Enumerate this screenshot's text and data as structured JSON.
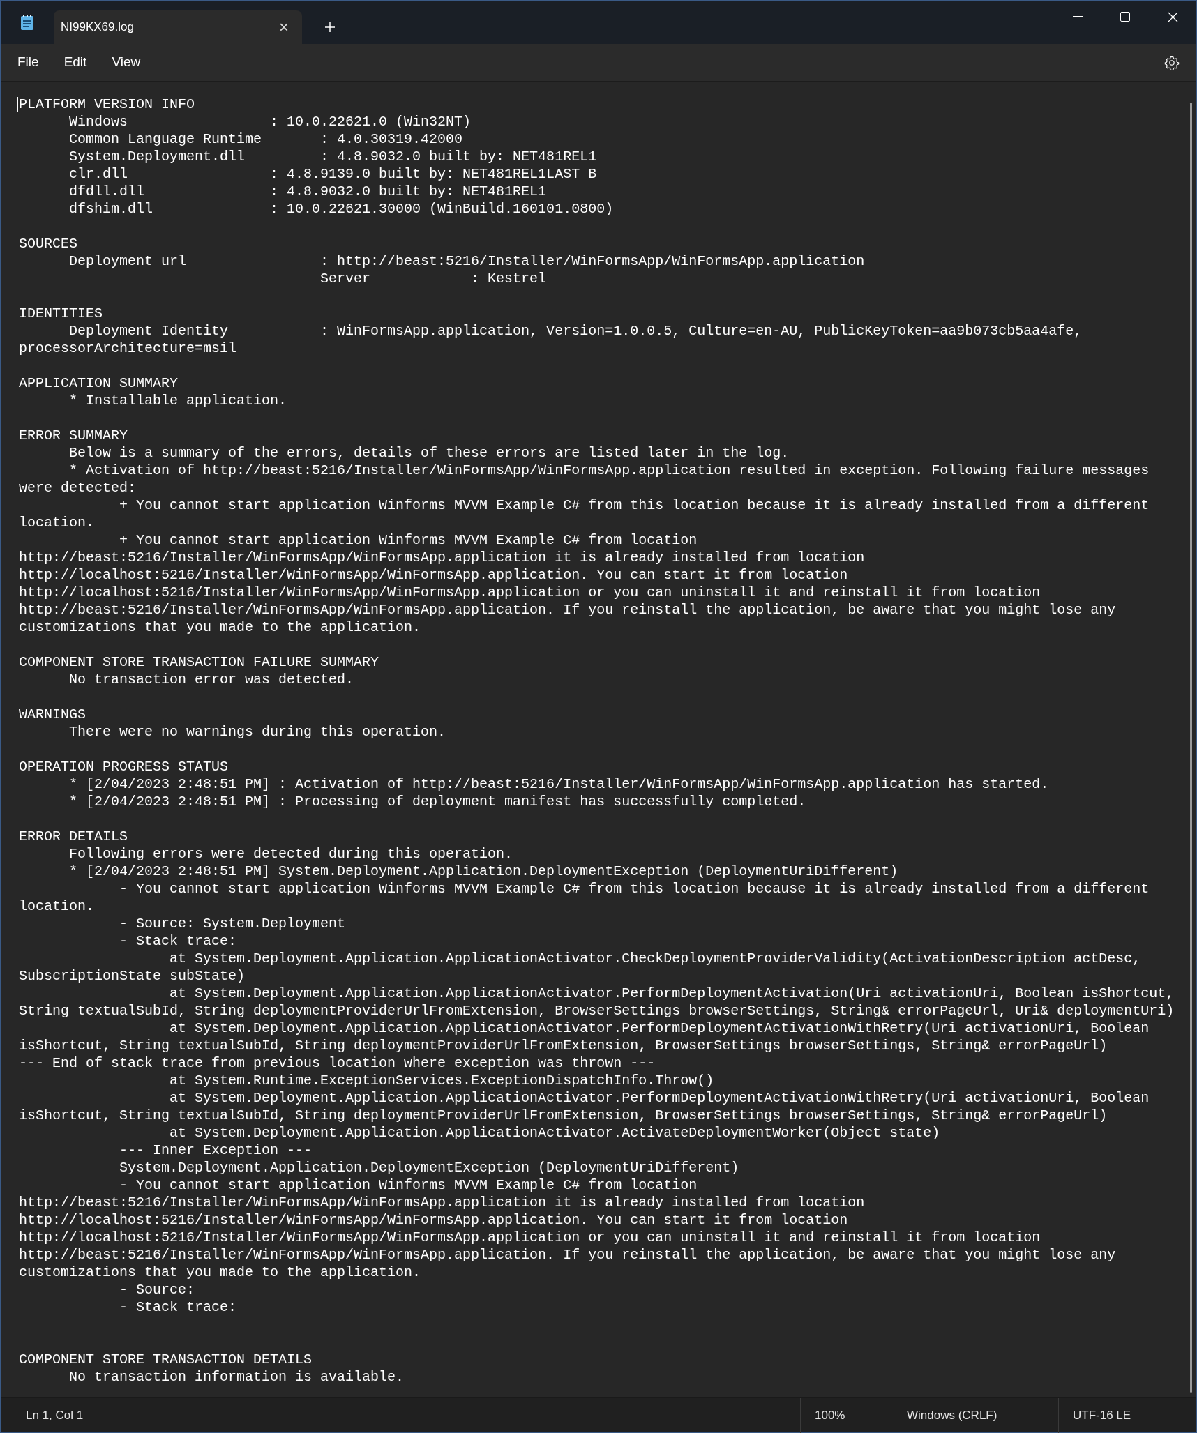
{
  "tabs": [
    {
      "label": "NI99KX69.log",
      "selected": true,
      "close": "×"
    }
  ],
  "menu": [
    "File",
    "Edit",
    "View"
  ],
  "editor": {
    "sections": [
      {
        "kind": "block",
        "lines": [
          "PLATFORM VERSION INFO",
          "      Windows                 : 10.0.22621.0 (Win32NT)",
          "      Common Language Runtime       : 4.0.30319.42000",
          "      System.Deployment.dll         : 4.8.9032.0 built by: NET481REL1",
          "      clr.dll                 : 4.8.9139.0 built by: NET481REL1LAST_B",
          "      dfdll.dll               : 4.8.9032.0 built by: NET481REL1",
          "      dfshim.dll              : 10.0.22621.30000 (WinBuild.160101.0800)"
        ]
      },
      {
        "kind": "block",
        "lines": [
          "SOURCES",
          "      Deployment url                : http://beast:5216/Installer/WinFormsApp/WinFormsApp.application",
          "                                    Server            : Kestrel"
        ]
      },
      {
        "kind": "block",
        "lines": [
          "IDENTITIES",
          "      Deployment Identity           : WinFormsApp.application, Version=1.0.0.5, Culture=en-AU, PublicKeyToken=aa9b073cb5aa4afe,",
          "processorArchitecture=msil"
        ]
      },
      {
        "kind": "block",
        "lines": [
          "APPLICATION SUMMARY",
          "      * Installable application."
        ]
      },
      {
        "kind": "block",
        "lines": [
          "ERROR SUMMARY",
          "      Below is a summary of the errors, details of these errors are listed later in the log.",
          "      * Activation of http://beast:5216/Installer/WinFormsApp/WinFormsApp.application resulted in exception. Following failure messages",
          "were detected:",
          "            + You cannot start application Winforms MVVM Example C# from this location because it is already installed from a different",
          "location.",
          "            + You cannot start application Winforms MVVM Example C# from location",
          "http://beast:5216/Installer/WinFormsApp/WinFormsApp.application it is already installed from location",
          "http://localhost:5216/Installer/WinFormsApp/WinFormsApp.application. You can start it from location",
          "http://localhost:5216/Installer/WinFormsApp/WinFormsApp.application or you can uninstall it and reinstall it from location",
          "http://beast:5216/Installer/WinFormsApp/WinFormsApp.application. If you reinstall the application, be aware that you might lose any",
          "customizations that you made to the application."
        ]
      },
      {
        "kind": "block",
        "lines": [
          "COMPONENT STORE TRANSACTION FAILURE SUMMARY",
          "      No transaction error was detected."
        ]
      },
      {
        "kind": "block",
        "lines": [
          "WARNINGS",
          "      There were no warnings during this operation."
        ]
      },
      {
        "kind": "block",
        "lines": [
          "OPERATION PROGRESS STATUS",
          "      * [2/04/2023 2:48:51 PM] : Activation of http://beast:5216/Installer/WinFormsApp/WinFormsApp.application has started.",
          "      * [2/04/2023 2:48:51 PM] : Processing of deployment manifest has successfully completed."
        ]
      },
      {
        "kind": "block",
        "lines": [
          "ERROR DETAILS",
          "      Following errors were detected during this operation.",
          "      * [2/04/2023 2:48:51 PM] System.Deployment.Application.DeploymentException (DeploymentUriDifferent)",
          "            - You cannot start application Winforms MVVM Example C# from this location because it is already installed from a different",
          "location.",
          "            - Source: System.Deployment",
          "            - Stack trace:",
          "                  at System.Deployment.Application.ApplicationActivator.CheckDeploymentProviderValidity(ActivationDescription actDesc,",
          "SubscriptionState subState)",
          "                  at System.Deployment.Application.ApplicationActivator.PerformDeploymentActivation(Uri activationUri, Boolean isShortcut,",
          "String textualSubId, String deploymentProviderUrlFromExtension, BrowserSettings browserSettings, String& errorPageUrl, Uri& deploymentUri)",
          "                  at System.Deployment.Application.ApplicationActivator.PerformDeploymentActivationWithRetry(Uri activationUri, Boolean",
          "isShortcut, String textualSubId, String deploymentProviderUrlFromExtension, BrowserSettings browserSettings, String& errorPageUrl)",
          "--- End of stack trace from previous location where exception was thrown ---",
          "                  at System.Runtime.ExceptionServices.ExceptionDispatchInfo.Throw()",
          "                  at System.Deployment.Application.ApplicationActivator.PerformDeploymentActivationWithRetry(Uri activationUri, Boolean",
          "isShortcut, String textualSubId, String deploymentProviderUrlFromExtension, BrowserSettings browserSettings, String& errorPageUrl)",
          "                  at System.Deployment.Application.ApplicationActivator.ActivateDeploymentWorker(Object state)",
          "            --- Inner Exception ---",
          "            System.Deployment.Application.DeploymentException (DeploymentUriDifferent)",
          "            - You cannot start application Winforms MVVM Example C# from location",
          "http://beast:5216/Installer/WinFormsApp/WinFormsApp.application it is already installed from location",
          "http://localhost:5216/Installer/WinFormsApp/WinFormsApp.application. You can start it from location",
          "http://localhost:5216/Installer/WinFormsApp/WinFormsApp.application or you can uninstall it and reinstall it from location",
          "http://beast:5216/Installer/WinFormsApp/WinFormsApp.application. If you reinstall the application, be aware that you might lose any",
          "customizations that you made to the application.",
          "            - Source:",
          "            - Stack trace:"
        ]
      },
      {
        "kind": "spaced",
        "lines": [
          "COMPONENT STORE TRANSACTION DETAILS",
          "      No transaction information is available."
        ]
      }
    ]
  },
  "status_bar": {
    "position": "Ln 1, Col 1",
    "zoom": "100%",
    "line_ending": "Windows (CRLF)",
    "encoding": "UTF-16 LE"
  }
}
